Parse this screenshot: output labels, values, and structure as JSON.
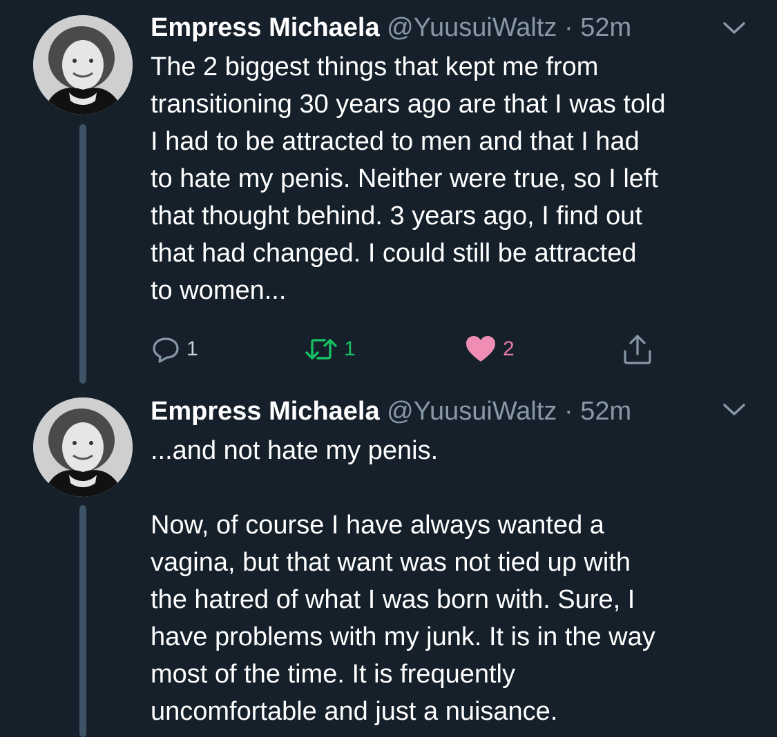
{
  "colors": {
    "background": "#15202b",
    "secondary_text": "#8899a6",
    "thread_line": "#3d5466",
    "retweet_active": "#17bf63",
    "like_active": "#e0245e"
  },
  "tweets": [
    {
      "author": {
        "name": "Empress Michaela",
        "handle": "@YuusuiWaltz",
        "separator": "·",
        "time": "52m"
      },
      "text_lines": [
        "The 2 biggest things that kept me from",
        "transitioning 30 years ago are that I was told",
        "I had to be attracted to men and that I had",
        "to hate my penis. Neither were true, so I left",
        "that thought behind. 3 years ago, I find out",
        "that had changed. I could still be attracted",
        "to women..."
      ],
      "actions": {
        "reply": {
          "icon": "reply-icon",
          "count": "1"
        },
        "retweet": {
          "icon": "retweet-icon",
          "count": "1",
          "active": true
        },
        "like": {
          "icon": "heart-icon",
          "count": "2",
          "active": true
        },
        "share": {
          "icon": "share-icon"
        }
      }
    },
    {
      "author": {
        "name": "Empress Michaela",
        "handle": "@YuusuiWaltz",
        "separator": "·",
        "time": "52m"
      },
      "paragraphs": [
        [
          "...and not hate my penis."
        ],
        [
          "Now, of course I have always wanted a",
          "vagina, but that want was not tied up with",
          "the hatred of what I was born with. Sure, I",
          "have problems with my junk. It is in the way",
          "most of the time. It is frequently",
          "uncomfortable and just a nuisance."
        ]
      ]
    }
  ]
}
